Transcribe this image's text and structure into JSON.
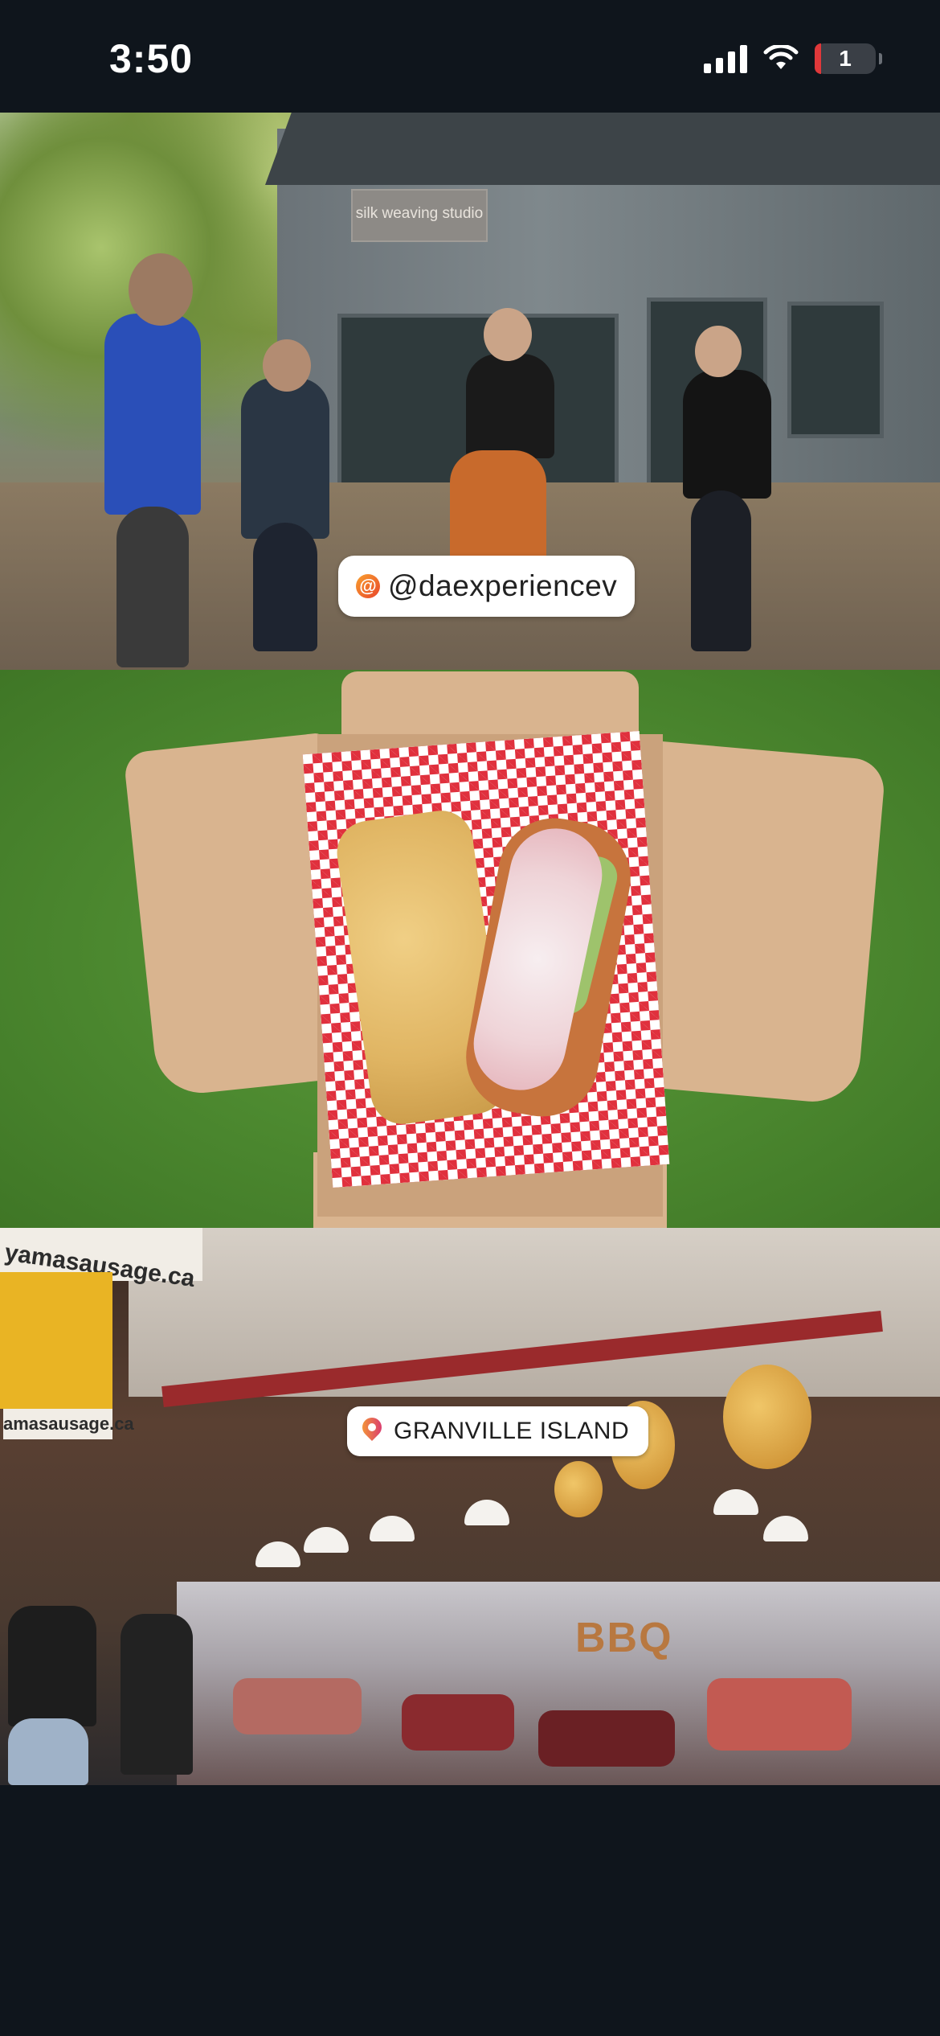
{
  "status_bar": {
    "time": "3:50",
    "battery_level": "1",
    "battery_color": "#e0383a",
    "icons": [
      "signal-icon",
      "wifi-icon",
      "battery-icon"
    ]
  },
  "story": {
    "photo1": {
      "shop_sign": "silk weaving studio",
      "mention_sticker": {
        "icon": "instagram-at-icon",
        "text": "@daexperiencev"
      }
    },
    "photo2": {},
    "photo3": {
      "banner_top": "yamasausage.ca",
      "banner_bottom": "amasausage.ca",
      "counter_sign": "BBQ",
      "location_sticker": {
        "icon": "location-pin-icon",
        "text": "GRANVILLE ISLAND"
      }
    }
  }
}
